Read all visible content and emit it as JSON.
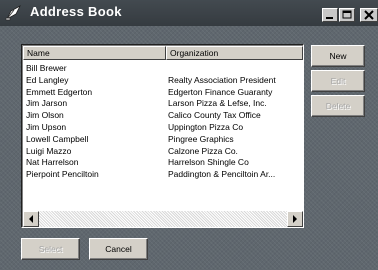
{
  "window": {
    "title": "Address Book",
    "icon": "address-book-quill-icon",
    "controls": {
      "minimize": "minimize-icon",
      "maximize": "maximize-icon",
      "close": "close-icon"
    }
  },
  "list": {
    "columns": [
      "Name",
      "Organization"
    ],
    "rows": [
      {
        "name": "Bill Brewer",
        "org": ""
      },
      {
        "name": "Ed Langley",
        "org": "Realty Association President"
      },
      {
        "name": "Emmett Edgerton",
        "org": "Edgerton Finance Guaranty"
      },
      {
        "name": "Jim Jarson",
        "org": "Larson Pizza & Lefse, Inc."
      },
      {
        "name": "Jim Olson",
        "org": "Calico County Tax Office"
      },
      {
        "name": "Jim Upson",
        "org": "Uppington Pizza Co"
      },
      {
        "name": "Lowell Campbell",
        "org": "Pingree Graphics"
      },
      {
        "name": "Luigi Mazzo",
        "org": "Calzone Pizza Co."
      },
      {
        "name": "Nat Harrelson",
        "org": "Harrelson Shingle Co"
      },
      {
        "name": "Pierpoint Penciltoin",
        "org": "Paddington & Penciltoin Ar..."
      }
    ]
  },
  "buttons": {
    "new": "New",
    "edit": "Edit",
    "delete": "Delete",
    "select": "Select",
    "cancel": "Cancel"
  },
  "scrollbar": {
    "left_icon": "arrow-left-icon",
    "right_icon": "arrow-right-icon"
  }
}
